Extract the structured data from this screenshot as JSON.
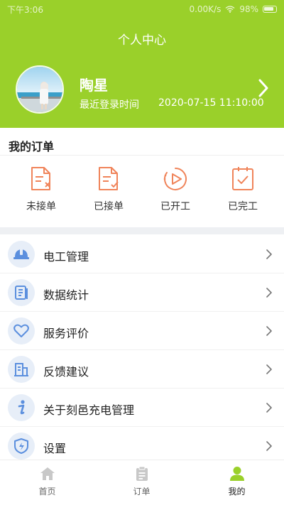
{
  "status_bar": {
    "time": "下午3:06",
    "speed": "0.00K/s",
    "battery": "98%"
  },
  "header": {
    "title": "个人中心",
    "user_name": "陶星",
    "login_label": "最近登录时间",
    "login_time": "2020-07-15 11:10:00",
    "bg_color": "#9ad02a"
  },
  "orders": {
    "title": "我的订单",
    "items": [
      {
        "label": "未接单",
        "icon": "doc-x-icon"
      },
      {
        "label": "已接单",
        "icon": "doc-check-icon"
      },
      {
        "label": "已开工",
        "icon": "play-icon"
      },
      {
        "label": "已完工",
        "icon": "clipboard-check-icon"
      }
    ],
    "accent_color": "#f0845a"
  },
  "menu": {
    "icon_color": "#5b8fde",
    "items": [
      {
        "label": "电工管理",
        "icon": "hardhat-icon"
      },
      {
        "label": "数据统计",
        "icon": "document-icon"
      },
      {
        "label": "服务评价",
        "icon": "heart-icon"
      },
      {
        "label": "反馈建议",
        "icon": "building-icon"
      },
      {
        "label": "关于刻邑充电管理",
        "icon": "info-icon"
      },
      {
        "label": "设置",
        "icon": "shield-bolt-icon"
      }
    ]
  },
  "tabbar": {
    "items": [
      {
        "label": "首页",
        "icon": "home-icon",
        "active": false
      },
      {
        "label": "订单",
        "icon": "clipboard-icon",
        "active": false
      },
      {
        "label": "我的",
        "icon": "user-icon",
        "active": true
      }
    ],
    "active_color": "#9ad02a",
    "inactive_color": "#c8c8c8"
  }
}
